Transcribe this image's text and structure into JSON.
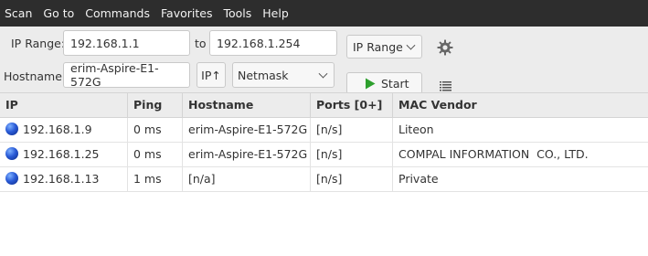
{
  "menu": [
    "Scan",
    "Go to",
    "Commands",
    "Favorites",
    "Tools",
    "Help"
  ],
  "toolbar": {
    "ip_range_label": "IP Range:",
    "ip_from": "192.168.1.1",
    "to_label": "to",
    "ip_to": "192.168.1.254",
    "feeder_select": "IP Range",
    "hostname_label": "Hostname:",
    "hostname_value": "erim-Aspire-E1-572G",
    "ip_up_button": "IP↑",
    "netmask_select": "Netmask",
    "start_button": "Start"
  },
  "table": {
    "columns": [
      "IP",
      "Ping",
      "Hostname",
      "Ports [0+]",
      "MAC Vendor"
    ],
    "rows": [
      [
        "192.168.1.9",
        "0 ms",
        "erim-Aspire-E1-572G",
        "[n/s]",
        "Liteon"
      ],
      [
        "192.168.1.25",
        "0 ms",
        "erim-Aspire-E1-572G",
        "[n/s]",
        "COMPAL INFORMATION  CO., LTD."
      ],
      [
        "192.168.1.13",
        "1 ms",
        "[n/a]",
        "[n/s]",
        "Private"
      ]
    ]
  },
  "colors": {
    "start_icon": "#2ea02e",
    "menubar_bg": "#2d2d2d",
    "toolbar_bg": "#ececec"
  }
}
